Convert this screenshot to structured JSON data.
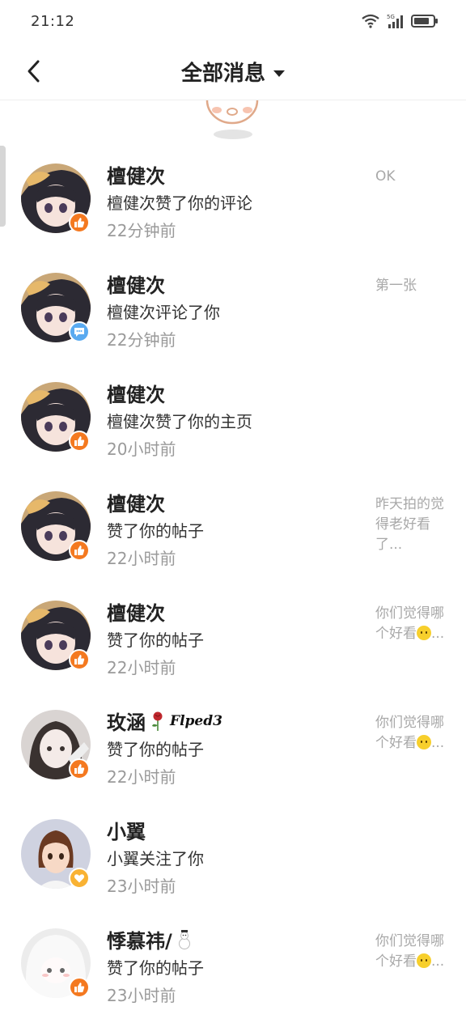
{
  "status_bar": {
    "time": "21:12"
  },
  "header": {
    "title": "全部消息"
  },
  "notifications": [
    {
      "name": "檀健次",
      "action": "檀健次赞了你的评论",
      "time": "22分钟前",
      "ref": "OK",
      "type": "like"
    },
    {
      "name": "檀健次",
      "action": "檀健次评论了你",
      "time": "22分钟前",
      "ref": "第一张",
      "type": "comment"
    },
    {
      "name": "檀健次",
      "action": "檀健次赞了你的主页",
      "time": "20小时前",
      "ref": "",
      "type": "like"
    },
    {
      "name": "檀健次",
      "action": "赞了你的帖子",
      "time": "22小时前",
      "ref": "昨天拍的觉得老好看了...",
      "type": "like"
    },
    {
      "name": "檀健次",
      "action": "赞了你的帖子",
      "time": "22小时前",
      "ref": "你们觉得哪个好看",
      "ref_tail": "...",
      "type": "like"
    },
    {
      "name": "玫涵",
      "name_sig": "Flped3",
      "action": "赞了你的帖子",
      "time": "22小时前",
      "ref": "你们觉得哪个好看",
      "ref_tail": "...",
      "type": "like"
    },
    {
      "name": "小翼",
      "action": "小翼关注了你",
      "time": "23小时前",
      "ref": "",
      "type": "follow"
    },
    {
      "name": "悸慕祎/",
      "action": "赞了你的帖子",
      "time": "23小时前",
      "ref": "你们觉得哪个好看",
      "ref_tail": "...",
      "type": "like"
    }
  ],
  "icons": {
    "like": "thumbs-up-icon",
    "comment": "chat-bubble-icon",
    "follow": "heart-icon"
  },
  "colors": {
    "like_badge": "#f47920",
    "comment_badge": "#5aaaf0",
    "follow_badge": "#f9b233",
    "secondary_text": "#9a9a9a"
  }
}
